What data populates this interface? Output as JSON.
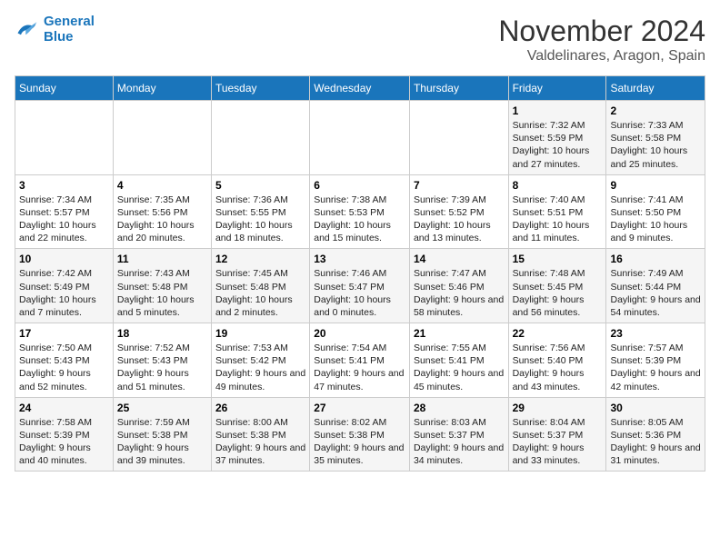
{
  "header": {
    "logo_line1": "General",
    "logo_line2": "Blue",
    "month": "November 2024",
    "location": "Valdelinares, Aragon, Spain"
  },
  "days_of_week": [
    "Sunday",
    "Monday",
    "Tuesday",
    "Wednesday",
    "Thursday",
    "Friday",
    "Saturday"
  ],
  "weeks": [
    [
      {
        "day": "",
        "info": ""
      },
      {
        "day": "",
        "info": ""
      },
      {
        "day": "",
        "info": ""
      },
      {
        "day": "",
        "info": ""
      },
      {
        "day": "",
        "info": ""
      },
      {
        "day": "1",
        "info": "Sunrise: 7:32 AM\nSunset: 5:59 PM\nDaylight: 10 hours and 27 minutes."
      },
      {
        "day": "2",
        "info": "Sunrise: 7:33 AM\nSunset: 5:58 PM\nDaylight: 10 hours and 25 minutes."
      }
    ],
    [
      {
        "day": "3",
        "info": "Sunrise: 7:34 AM\nSunset: 5:57 PM\nDaylight: 10 hours and 22 minutes."
      },
      {
        "day": "4",
        "info": "Sunrise: 7:35 AM\nSunset: 5:56 PM\nDaylight: 10 hours and 20 minutes."
      },
      {
        "day": "5",
        "info": "Sunrise: 7:36 AM\nSunset: 5:55 PM\nDaylight: 10 hours and 18 minutes."
      },
      {
        "day": "6",
        "info": "Sunrise: 7:38 AM\nSunset: 5:53 PM\nDaylight: 10 hours and 15 minutes."
      },
      {
        "day": "7",
        "info": "Sunrise: 7:39 AM\nSunset: 5:52 PM\nDaylight: 10 hours and 13 minutes."
      },
      {
        "day": "8",
        "info": "Sunrise: 7:40 AM\nSunset: 5:51 PM\nDaylight: 10 hours and 11 minutes."
      },
      {
        "day": "9",
        "info": "Sunrise: 7:41 AM\nSunset: 5:50 PM\nDaylight: 10 hours and 9 minutes."
      }
    ],
    [
      {
        "day": "10",
        "info": "Sunrise: 7:42 AM\nSunset: 5:49 PM\nDaylight: 10 hours and 7 minutes."
      },
      {
        "day": "11",
        "info": "Sunrise: 7:43 AM\nSunset: 5:48 PM\nDaylight: 10 hours and 5 minutes."
      },
      {
        "day": "12",
        "info": "Sunrise: 7:45 AM\nSunset: 5:48 PM\nDaylight: 10 hours and 2 minutes."
      },
      {
        "day": "13",
        "info": "Sunrise: 7:46 AM\nSunset: 5:47 PM\nDaylight: 10 hours and 0 minutes."
      },
      {
        "day": "14",
        "info": "Sunrise: 7:47 AM\nSunset: 5:46 PM\nDaylight: 9 hours and 58 minutes."
      },
      {
        "day": "15",
        "info": "Sunrise: 7:48 AM\nSunset: 5:45 PM\nDaylight: 9 hours and 56 minutes."
      },
      {
        "day": "16",
        "info": "Sunrise: 7:49 AM\nSunset: 5:44 PM\nDaylight: 9 hours and 54 minutes."
      }
    ],
    [
      {
        "day": "17",
        "info": "Sunrise: 7:50 AM\nSunset: 5:43 PM\nDaylight: 9 hours and 52 minutes."
      },
      {
        "day": "18",
        "info": "Sunrise: 7:52 AM\nSunset: 5:43 PM\nDaylight: 9 hours and 51 minutes."
      },
      {
        "day": "19",
        "info": "Sunrise: 7:53 AM\nSunset: 5:42 PM\nDaylight: 9 hours and 49 minutes."
      },
      {
        "day": "20",
        "info": "Sunrise: 7:54 AM\nSunset: 5:41 PM\nDaylight: 9 hours and 47 minutes."
      },
      {
        "day": "21",
        "info": "Sunrise: 7:55 AM\nSunset: 5:41 PM\nDaylight: 9 hours and 45 minutes."
      },
      {
        "day": "22",
        "info": "Sunrise: 7:56 AM\nSunset: 5:40 PM\nDaylight: 9 hours and 43 minutes."
      },
      {
        "day": "23",
        "info": "Sunrise: 7:57 AM\nSunset: 5:39 PM\nDaylight: 9 hours and 42 minutes."
      }
    ],
    [
      {
        "day": "24",
        "info": "Sunrise: 7:58 AM\nSunset: 5:39 PM\nDaylight: 9 hours and 40 minutes."
      },
      {
        "day": "25",
        "info": "Sunrise: 7:59 AM\nSunset: 5:38 PM\nDaylight: 9 hours and 39 minutes."
      },
      {
        "day": "26",
        "info": "Sunrise: 8:00 AM\nSunset: 5:38 PM\nDaylight: 9 hours and 37 minutes."
      },
      {
        "day": "27",
        "info": "Sunrise: 8:02 AM\nSunset: 5:38 PM\nDaylight: 9 hours and 35 minutes."
      },
      {
        "day": "28",
        "info": "Sunrise: 8:03 AM\nSunset: 5:37 PM\nDaylight: 9 hours and 34 minutes."
      },
      {
        "day": "29",
        "info": "Sunrise: 8:04 AM\nSunset: 5:37 PM\nDaylight: 9 hours and 33 minutes."
      },
      {
        "day": "30",
        "info": "Sunrise: 8:05 AM\nSunset: 5:36 PM\nDaylight: 9 hours and 31 minutes."
      }
    ]
  ]
}
